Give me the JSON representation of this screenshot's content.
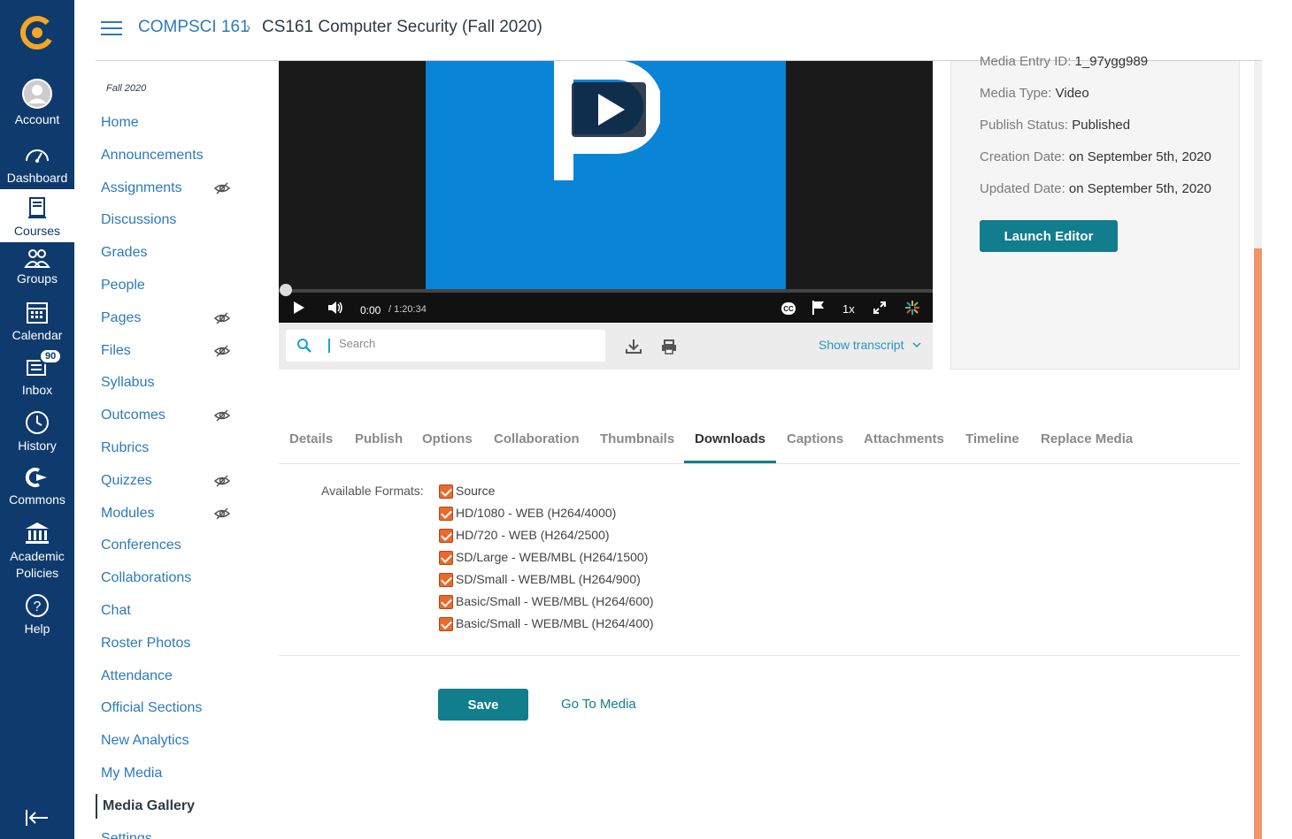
{
  "global_nav": {
    "items": [
      {
        "label": "Account",
        "icon": "account-avatar-icon"
      },
      {
        "label": "Dashboard",
        "icon": "dashboard-icon"
      },
      {
        "label": "Courses",
        "icon": "courses-icon",
        "active": true
      },
      {
        "label": "Groups",
        "icon": "groups-icon"
      },
      {
        "label": "Calendar",
        "icon": "calendar-icon"
      },
      {
        "label": "Inbox",
        "icon": "inbox-icon",
        "badge": "90"
      },
      {
        "label": "History",
        "icon": "history-icon"
      },
      {
        "label": "Commons",
        "icon": "commons-icon"
      },
      {
        "label": "Academic Policies",
        "icon": "academic-policies-icon"
      },
      {
        "label": "Help",
        "icon": "help-icon"
      }
    ],
    "colors": {
      "background": "#0f3a6e",
      "logo": "#f5a623"
    }
  },
  "header": {
    "course_code": "COMPSCI 161",
    "separator": "›",
    "current_page": "CS161 Computer Security (Fall 2020)"
  },
  "course_nav": {
    "term": "Fall 2020",
    "items": [
      {
        "label": "Home",
        "hidden": false
      },
      {
        "label": "Announcements",
        "hidden": false
      },
      {
        "label": "Assignments",
        "hidden": true
      },
      {
        "label": "Discussions",
        "hidden": false
      },
      {
        "label": "Grades",
        "hidden": false
      },
      {
        "label": "People",
        "hidden": false
      },
      {
        "label": "Pages",
        "hidden": true
      },
      {
        "label": "Files",
        "hidden": true
      },
      {
        "label": "Syllabus",
        "hidden": false
      },
      {
        "label": "Outcomes",
        "hidden": true
      },
      {
        "label": "Rubrics",
        "hidden": false
      },
      {
        "label": "Quizzes",
        "hidden": true
      },
      {
        "label": "Modules",
        "hidden": true
      },
      {
        "label": "Conferences",
        "hidden": false
      },
      {
        "label": "Collaborations",
        "hidden": false
      },
      {
        "label": "Chat",
        "hidden": false
      },
      {
        "label": "Roster Photos",
        "hidden": false
      },
      {
        "label": "Attendance",
        "hidden": false
      },
      {
        "label": "Official Sections",
        "hidden": false
      },
      {
        "label": "New Analytics",
        "hidden": false
      },
      {
        "label": "My Media",
        "hidden": false
      },
      {
        "label": "Media Gallery",
        "hidden": false,
        "active": true
      },
      {
        "label": "Settings",
        "hidden": false
      }
    ]
  },
  "player": {
    "current_time": "0:00",
    "duration": "/ 1:20:34",
    "speed": "1x",
    "progress_fraction": 0
  },
  "transcript_bar": {
    "search_placeholder": "Search",
    "show_transcript": "Show transcript"
  },
  "details": {
    "media_entry_id_label": "Media Entry ID:",
    "media_entry_id_value": "1_97ygg989",
    "media_type_label": "Media Type:",
    "media_type_value": "Video",
    "publish_status_label": "Publish Status:",
    "publish_status_value": "Published",
    "creation_date_label": "Creation Date:",
    "creation_date_value": "on September 5th, 2020",
    "updated_date_label": "Updated Date:",
    "updated_date_value": "on September 5th, 2020",
    "launch_editor": "Launch Editor"
  },
  "tabs": {
    "items": [
      "Details",
      "Publish",
      "Options",
      "Collaboration",
      "Thumbnails",
      "Downloads",
      "Captions",
      "Attachments",
      "Timeline",
      "Replace Media"
    ],
    "active": "Downloads"
  },
  "downloads": {
    "label": "Available Formats:",
    "formats": [
      {
        "label": "Source",
        "checked": true
      },
      {
        "label": "HD/1080 - WEB (H264/4000)",
        "checked": true
      },
      {
        "label": "HD/720 - WEB (H264/2500)",
        "checked": true
      },
      {
        "label": "SD/Large - WEB/MBL (H264/1500)",
        "checked": true
      },
      {
        "label": "SD/Small - WEB/MBL (H264/900)",
        "checked": true
      },
      {
        "label": "Basic/Small - WEB/MBL (H264/600)",
        "checked": true
      },
      {
        "label": "Basic/Small - WEB/MBL (H264/400)",
        "checked": true
      }
    ],
    "save": "Save",
    "go_to_media": "Go To Media"
  }
}
